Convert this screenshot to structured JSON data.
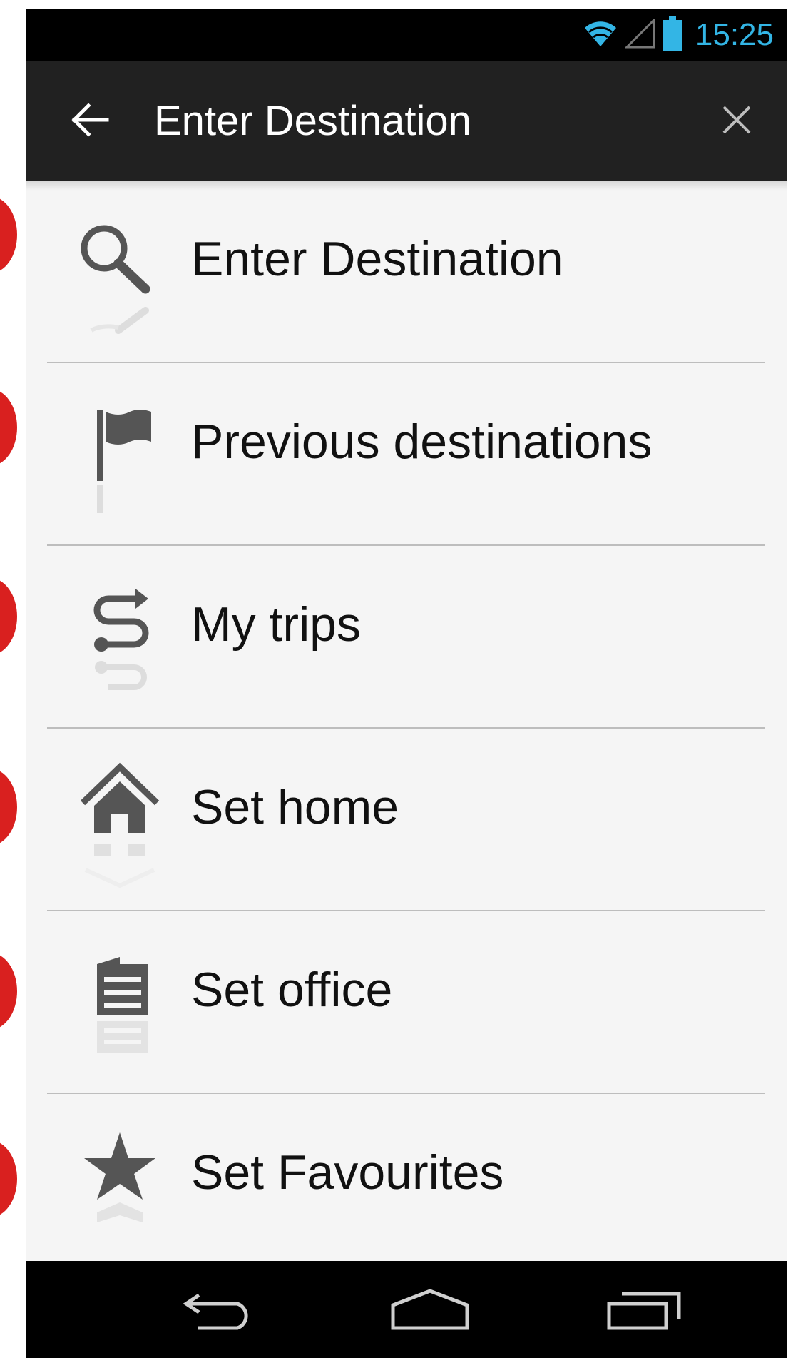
{
  "status_bar": {
    "time": "15:25",
    "icons": [
      "wifi-icon",
      "signal-icon",
      "battery-icon"
    ],
    "time_color": "#33b5e5"
  },
  "action_bar": {
    "title": "Enter Destination",
    "back_icon": "arrow-left-icon",
    "close_icon": "close-icon"
  },
  "menu": {
    "items": [
      {
        "label": "Enter Destination",
        "icon": "search-icon"
      },
      {
        "label": "Previous destinations",
        "icon": "flag-icon"
      },
      {
        "label": "My trips",
        "icon": "route-icon"
      },
      {
        "label": "Set home",
        "icon": "home-icon"
      },
      {
        "label": "Set office",
        "icon": "office-icon"
      },
      {
        "label": "Set Favourites",
        "icon": "star-icon"
      }
    ]
  },
  "nav_bar": {
    "buttons": [
      "back-nav-icon",
      "home-nav-icon",
      "recents-nav-icon"
    ]
  },
  "colors": {
    "marker": "#d9201f",
    "action_bar": "#212121",
    "list_background": "#f5f5f5"
  }
}
